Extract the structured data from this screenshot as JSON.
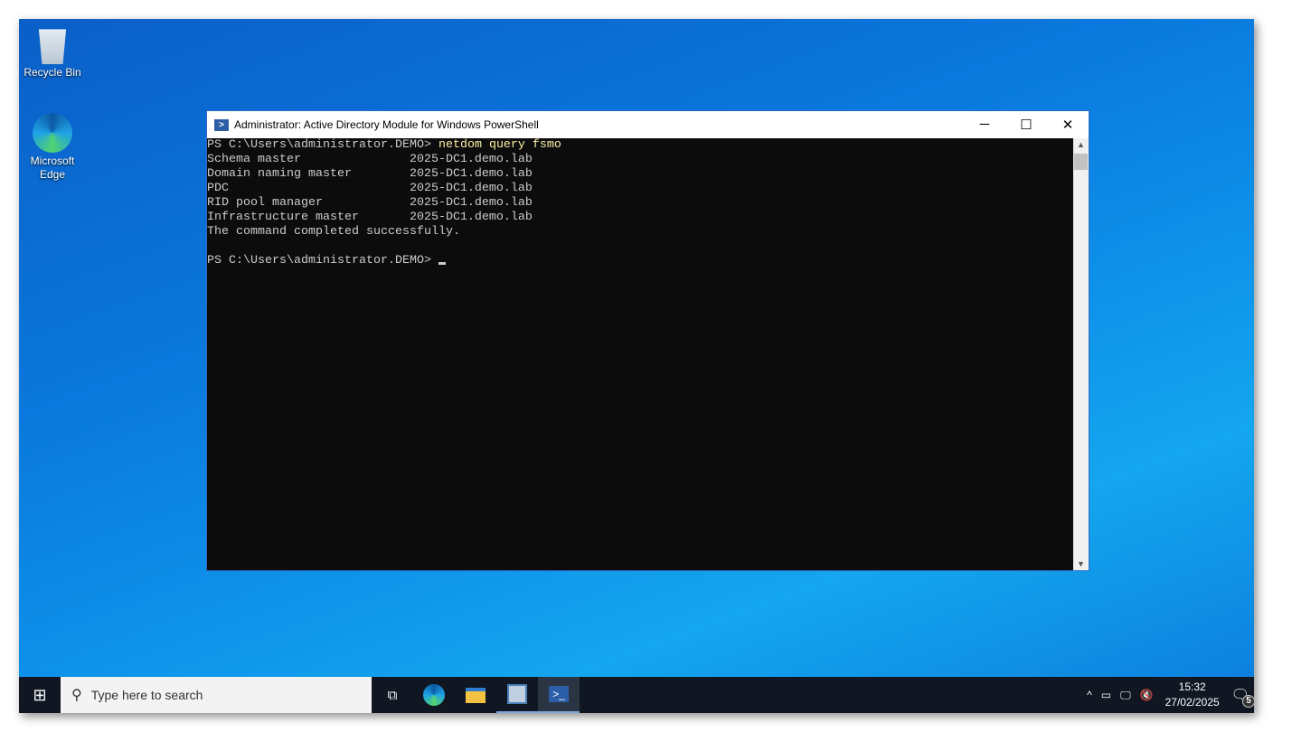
{
  "desktop": {
    "icons": [
      {
        "label": "Recycle Bin"
      },
      {
        "label": "Microsoft Edge"
      }
    ]
  },
  "window": {
    "title": "Administrator: Active Directory Module for Windows PowerShell",
    "controls": {
      "minimize": "─",
      "maximize": "☐",
      "close": "✕"
    },
    "console": {
      "prompt": "PS C:\\Users\\administrator.DEMO> ",
      "command": "netdom query fsmo",
      "output": [
        "Schema master               2025-DC1.demo.lab",
        "Domain naming master        2025-DC1.demo.lab",
        "PDC                         2025-DC1.demo.lab",
        "RID pool manager            2025-DC1.demo.lab",
        "Infrastructure master       2025-DC1.demo.lab",
        "The command completed successfully."
      ],
      "prompt2": "PS C:\\Users\\administrator.DEMO> "
    }
  },
  "taskbar": {
    "search_placeholder": "Type here to search",
    "time": "15:32",
    "date": "27/02/2025",
    "notifications": "5"
  }
}
